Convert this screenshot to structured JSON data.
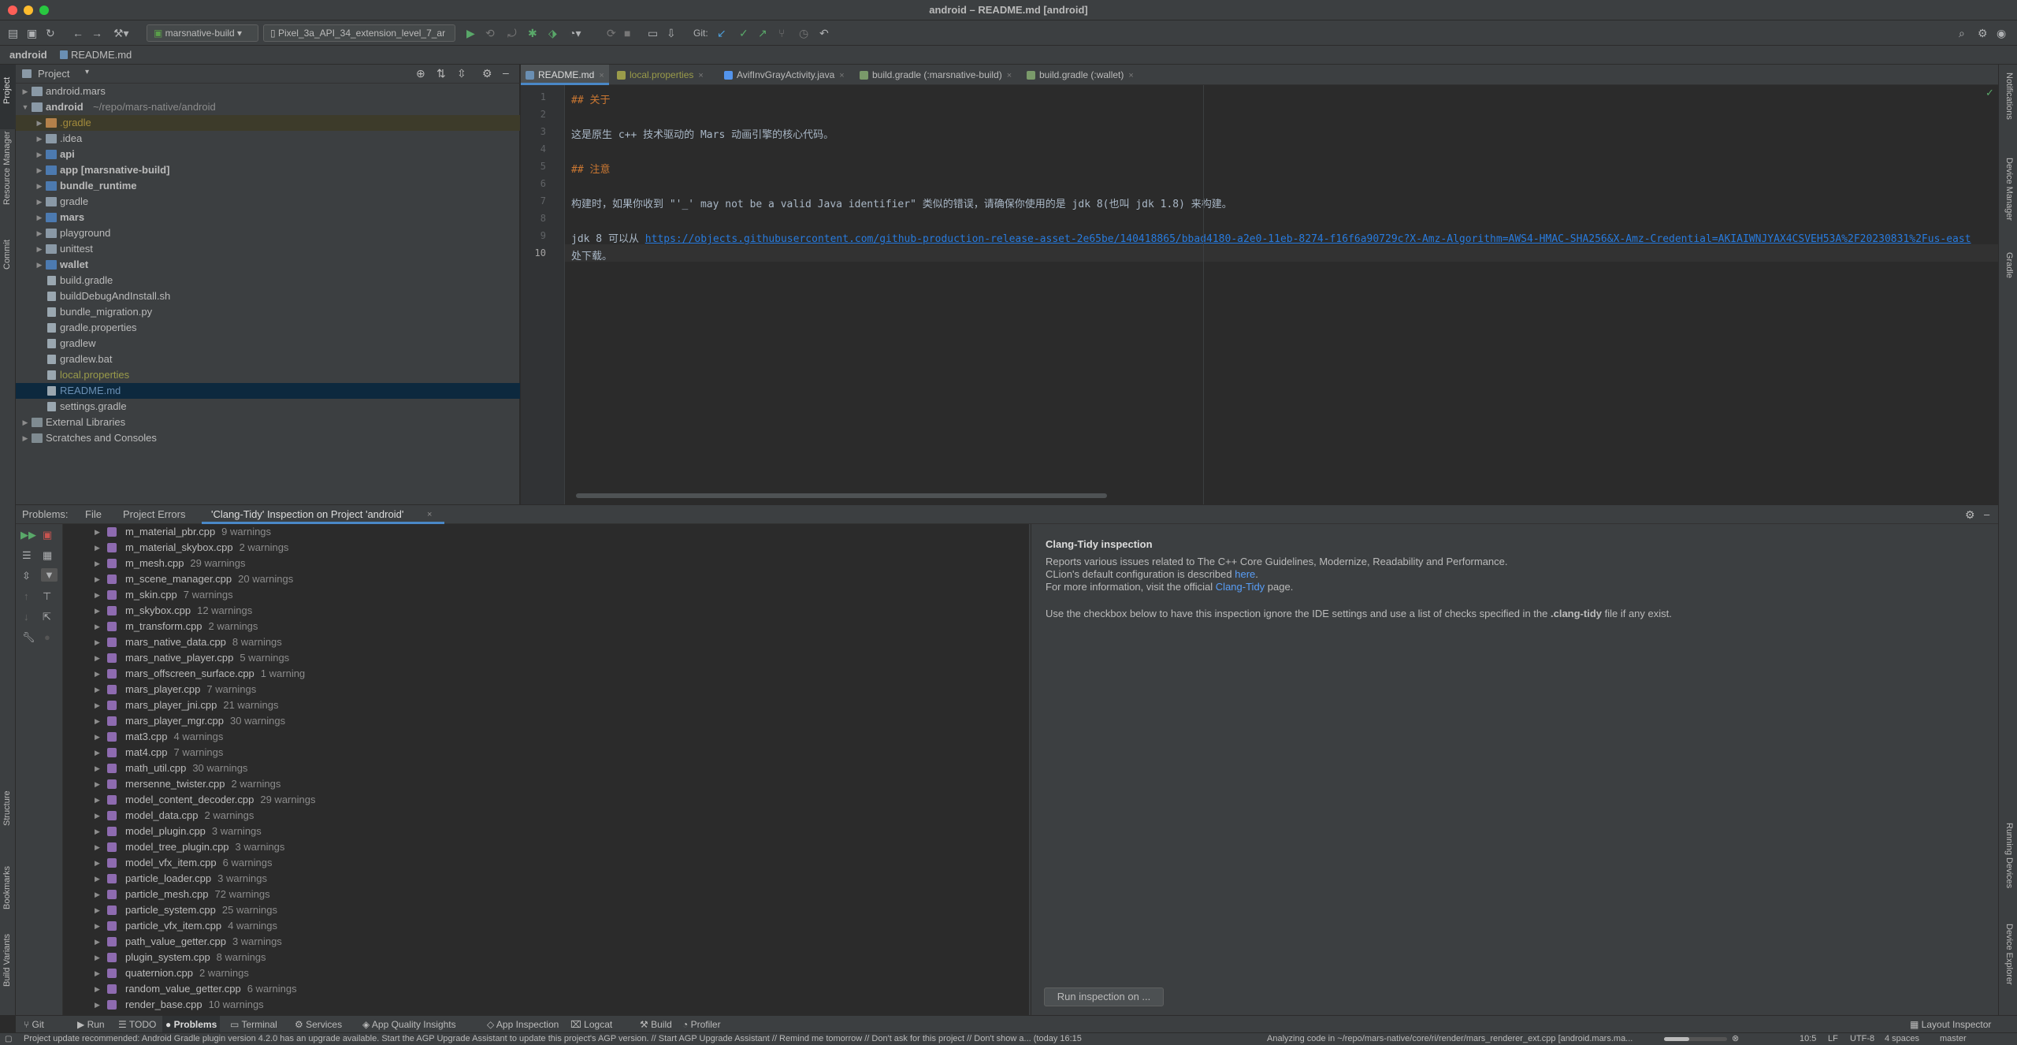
{
  "window": {
    "title": "android – README.md [android]"
  },
  "toolbar": {
    "config": "marsnative-build",
    "device": "Pixel_3a_API_34_extension_level_7_ar",
    "git_label": "Git:"
  },
  "breadcrumb": {
    "project": "android",
    "file": "README.md"
  },
  "left_strip": {
    "project": "Project",
    "resource_manager": "Resource Manager",
    "commit": "Commit",
    "structure": "Structure",
    "bookmarks": "Bookmarks",
    "build_variants": "Build Variants"
  },
  "right_strip": {
    "notifications": "Notifications",
    "device_manager": "Device Manager",
    "gradle": "Gradle",
    "running_devices": "Running Devices",
    "device_explorer": "Device Explorer"
  },
  "project_panel": {
    "title": "Project",
    "tree": [
      {
        "label": "android.mars",
        "sub": "",
        "type": "folder",
        "depth": 0,
        "expanded": false
      },
      {
        "label": "android",
        "sub": "~/repo/mars-native/android",
        "type": "folder",
        "depth": 0,
        "expanded": true,
        "bold": true
      },
      {
        "label": ".gradle",
        "sub": "",
        "type": "folder-orange",
        "depth": 1,
        "expanded": false,
        "highlight": "yellow"
      },
      {
        "label": ".idea",
        "sub": "",
        "type": "folder",
        "depth": 1,
        "expanded": false
      },
      {
        "label": "api",
        "sub": "",
        "type": "folder-blue",
        "depth": 1,
        "expanded": false,
        "bold": true
      },
      {
        "label": "app [marsnative-build]",
        "sub": "",
        "type": "folder-blue",
        "depth": 1,
        "expanded": false,
        "bold": true
      },
      {
        "label": "bundle_runtime",
        "sub": "",
        "type": "folder-blue",
        "depth": 1,
        "expanded": false,
        "bold": true
      },
      {
        "label": "gradle",
        "sub": "",
        "type": "folder",
        "depth": 1,
        "expanded": false
      },
      {
        "label": "mars",
        "sub": "",
        "type": "folder-blue",
        "depth": 1,
        "expanded": false,
        "bold": true
      },
      {
        "label": "playground",
        "sub": "",
        "type": "folder",
        "depth": 1,
        "expanded": false
      },
      {
        "label": "unittest",
        "sub": "",
        "type": "folder",
        "depth": 1,
        "expanded": false
      },
      {
        "label": "wallet",
        "sub": "",
        "type": "folder-blue",
        "depth": 1,
        "expanded": false,
        "bold": true
      },
      {
        "label": "build.gradle",
        "sub": "",
        "type": "file",
        "depth": 1
      },
      {
        "label": "buildDebugAndInstall.sh",
        "sub": "",
        "type": "file",
        "depth": 1
      },
      {
        "label": "bundle_migration.py",
        "sub": "",
        "type": "file",
        "depth": 1
      },
      {
        "label": "gradle.properties",
        "sub": "",
        "type": "file",
        "depth": 1
      },
      {
        "label": "gradlew",
        "sub": "",
        "type": "file",
        "depth": 1
      },
      {
        "label": "gradlew.bat",
        "sub": "",
        "type": "file",
        "depth": 1
      },
      {
        "label": "local.properties",
        "sub": "",
        "type": "file",
        "depth": 1,
        "color": "olive"
      },
      {
        "label": "README.md",
        "sub": "",
        "type": "file",
        "depth": 1,
        "selected": true,
        "color": "blue"
      },
      {
        "label": "settings.gradle",
        "sub": "",
        "type": "file",
        "depth": 1
      },
      {
        "label": "External Libraries",
        "sub": "",
        "type": "lib",
        "depth": 0,
        "expanded": false
      },
      {
        "label": "Scratches and Consoles",
        "sub": "",
        "type": "lib",
        "depth": 0,
        "expanded": false
      }
    ]
  },
  "editor": {
    "tabs": [
      {
        "label": "README.md",
        "active": true,
        "color": "#6a8fb3"
      },
      {
        "label": "local.properties",
        "active": false,
        "color": "#9a9b4a"
      },
      {
        "label": "AvifInvGrayActivity.java",
        "active": false,
        "color": "#5394ec"
      },
      {
        "label": "build.gradle (:marsnative-build)",
        "active": false,
        "color": "#7a9a6a"
      },
      {
        "label": "build.gradle (:wallet)",
        "active": false,
        "color": "#7a9a6a"
      }
    ],
    "lines": [
      {
        "n": "1",
        "text": "## 关于",
        "kind": "h"
      },
      {
        "n": "2",
        "text": "",
        "kind": "p"
      },
      {
        "n": "3",
        "text": "这是原生 c++ 技术驱动的 Mars 动画引擎的核心代码。",
        "kind": "p"
      },
      {
        "n": "4",
        "text": "",
        "kind": "p"
      },
      {
        "n": "5",
        "text": "## 注意",
        "kind": "h"
      },
      {
        "n": "6",
        "text": "",
        "kind": "p"
      },
      {
        "n": "7",
        "text": "构建时，如果你收到 \"'_' may not be a valid Java identifier\" 类似的错误，请确保你使用的是 jdk 8(也叫 jdk 1.8) 来构建。",
        "kind": "p"
      },
      {
        "n": "8",
        "text": "",
        "kind": "p"
      },
      {
        "n": "9",
        "text": "jdk 8 可以从 ",
        "link": "https://objects.githubusercontent.com/github-production-release-asset-2e65be/140418865/bbad4180-a2e0-11eb-8274-f16f6a90729c?X-Amz-Algorithm=AWS4-HMAC-SHA256&X-Amz-Credential=AKIAIWNJYAX4CSVEH53A%2F20230831%2Fus-east",
        "kind": "link"
      },
      {
        "n": "10",
        "text": "处下载。",
        "kind": "p"
      }
    ]
  },
  "problems": {
    "label": "Problems:",
    "tabs": [
      "File",
      "Project Errors",
      "'Clang-Tidy' Inspection on Project 'android'"
    ],
    "items": [
      {
        "name": "m_material_pbr.cpp",
        "count": "9 warnings"
      },
      {
        "name": "m_material_skybox.cpp",
        "count": "2 warnings"
      },
      {
        "name": "m_mesh.cpp",
        "count": "29 warnings"
      },
      {
        "name": "m_scene_manager.cpp",
        "count": "20 warnings"
      },
      {
        "name": "m_skin.cpp",
        "count": "7 warnings"
      },
      {
        "name": "m_skybox.cpp",
        "count": "12 warnings"
      },
      {
        "name": "m_transform.cpp",
        "count": "2 warnings"
      },
      {
        "name": "mars_native_data.cpp",
        "count": "8 warnings"
      },
      {
        "name": "mars_native_player.cpp",
        "count": "5 warnings"
      },
      {
        "name": "mars_offscreen_surface.cpp",
        "count": "1 warning"
      },
      {
        "name": "mars_player.cpp",
        "count": "7 warnings"
      },
      {
        "name": "mars_player_jni.cpp",
        "count": "21 warnings"
      },
      {
        "name": "mars_player_mgr.cpp",
        "count": "30 warnings"
      },
      {
        "name": "mat3.cpp",
        "count": "4 warnings"
      },
      {
        "name": "mat4.cpp",
        "count": "7 warnings"
      },
      {
        "name": "math_util.cpp",
        "count": "30 warnings"
      },
      {
        "name": "mersenne_twister.cpp",
        "count": "2 warnings"
      },
      {
        "name": "model_content_decoder.cpp",
        "count": "29 warnings"
      },
      {
        "name": "model_data.cpp",
        "count": "2 warnings"
      },
      {
        "name": "model_plugin.cpp",
        "count": "3 warnings"
      },
      {
        "name": "model_tree_plugin.cpp",
        "count": "3 warnings"
      },
      {
        "name": "model_vfx_item.cpp",
        "count": "6 warnings"
      },
      {
        "name": "particle_loader.cpp",
        "count": "3 warnings"
      },
      {
        "name": "particle_mesh.cpp",
        "count": "72 warnings"
      },
      {
        "name": "particle_system.cpp",
        "count": "25 warnings"
      },
      {
        "name": "particle_vfx_item.cpp",
        "count": "4 warnings"
      },
      {
        "name": "path_value_getter.cpp",
        "count": "3 warnings"
      },
      {
        "name": "plugin_system.cpp",
        "count": "8 warnings"
      },
      {
        "name": "quaternion.cpp",
        "count": "2 warnings"
      },
      {
        "name": "random_value_getter.cpp",
        "count": "6 warnings"
      },
      {
        "name": "render_base.cpp",
        "count": "10 warnings"
      }
    ]
  },
  "inspection": {
    "title": "Clang-Tidy inspection",
    "line1": "Reports various issues related to The C++ Core Guidelines, Modernize, Readability and Performance.",
    "line2_pre": "CLion's default configuration is described ",
    "line2_link": "here",
    "line2_post": ".",
    "line3_pre": "For more information, visit the official ",
    "line3_link": "Clang-Tidy",
    "line3_post": " page.",
    "line4_pre": "Use the checkbox below to have this inspection ignore the IDE settings and use a list of checks specified in the ",
    "line4_bold": ".clang-tidy",
    "line4_post": " file if any exist.",
    "run_button": "Run inspection on ..."
  },
  "tool_windows": [
    "Git",
    "Run",
    "TODO",
    "Problems",
    "Terminal",
    "Services",
    "App Quality Insights",
    "App Inspection",
    "Logcat",
    "Build",
    "Profiler"
  ],
  "layout_inspector": "Layout Inspector",
  "status": {
    "message": "Project update recommended: Android Gradle plugin version 4.2.0 has an upgrade available.  Start the AGP Upgrade Assistant to update this project's AGP version. // Start AGP Upgrade Assistant // Remind me tomorrow // Don't ask for this project // Don't show a... (today 16:15",
    "analyzing": "Analyzing code in ~/repo/mars-native/core/ri/render/mars_renderer_ext.cpp [android.mars.ma...",
    "position": "10:5",
    "line_sep": "LF",
    "encoding": "UTF-8",
    "indent": "4 spaces",
    "branch": "master"
  }
}
